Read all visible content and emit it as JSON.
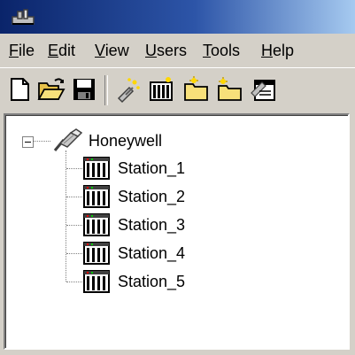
{
  "menu": {
    "file": {
      "label": "File",
      "mnemonic": "F",
      "rest": "ile"
    },
    "edit": {
      "label": "Edit",
      "mnemonic": "E",
      "rest": "dit"
    },
    "view": {
      "label": "View",
      "mnemonic": "V",
      "rest": "iew"
    },
    "users": {
      "label": "Users",
      "mnemonic": "U",
      "rest": "sers"
    },
    "tools": {
      "label": "Tools",
      "mnemonic": "T",
      "rest": "ools"
    },
    "help": {
      "label": "Help",
      "mnemonic": "H",
      "rest": "elp"
    }
  },
  "toolbar": {
    "buttons": [
      "new-document-icon",
      "open-folder-icon",
      "save-disk-icon",
      "connect-wand-icon",
      "add-station-icon",
      "new-folder-icon",
      "add-item-icon",
      "properties-icon"
    ]
  },
  "tree": {
    "root": {
      "label": "Honeywell",
      "icon": "network-cable-icon",
      "expanded": true
    },
    "children": [
      {
        "label": "Station_1"
      },
      {
        "label": "Station_2"
      },
      {
        "label": "Station_3"
      },
      {
        "label": "Station_4"
      },
      {
        "label": "Station_5"
      }
    ]
  },
  "colors": {
    "titlebar_start": "#0a246a",
    "titlebar_end": "#a6caf0",
    "face": "#d4d0c8"
  }
}
